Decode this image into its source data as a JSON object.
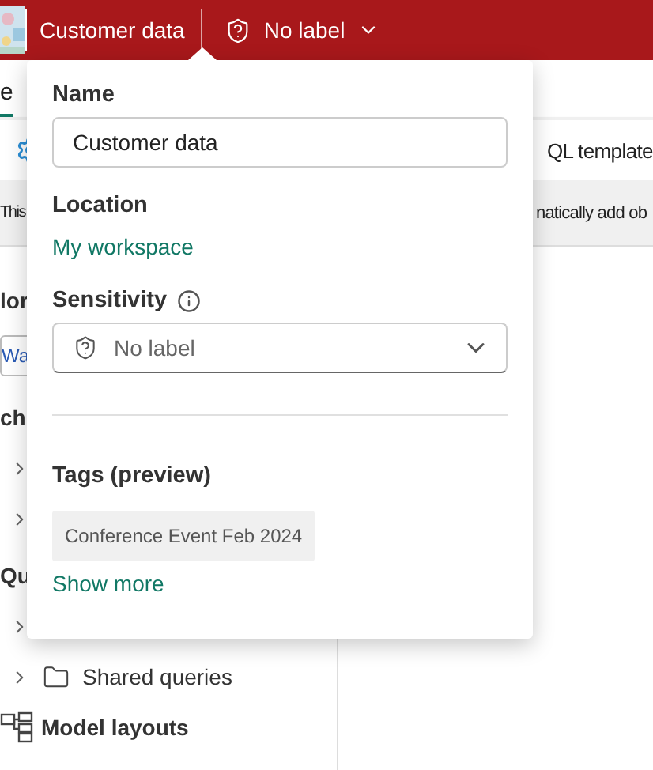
{
  "app_bar": {
    "item_name": "Customer data",
    "sensitivity": "No label"
  },
  "background": {
    "tab": {
      "label": "e",
      "selected": true
    },
    "toolbar_text": "QL template",
    "banner_left": "This",
    "banner_right": "natically add ob",
    "sidebar": [
      {
        "kind": "heading",
        "label": "lor"
      },
      {
        "kind": "field",
        "value": "Wa"
      },
      {
        "kind": "heading",
        "label": "ch"
      },
      {
        "kind": "node",
        "expanded": false
      },
      {
        "kind": "node",
        "expanded": false
      },
      {
        "kind": "heading",
        "label": "Qu"
      },
      {
        "kind": "node",
        "expanded": false
      },
      {
        "kind": "folder",
        "label": "Shared queries",
        "expanded": false
      },
      {
        "kind": "layouts",
        "label": "Model layouts"
      }
    ]
  },
  "popover": {
    "name": {
      "label": "Name",
      "value": "Customer data"
    },
    "location": {
      "label": "Location",
      "value": "My workspace"
    },
    "sensitivity": {
      "label": "Sensitivity",
      "value": "No label"
    },
    "tags": {
      "label": "Tags (preview)",
      "items": [
        "Conference Event Feb 2024"
      ],
      "more": "Show more"
    }
  }
}
